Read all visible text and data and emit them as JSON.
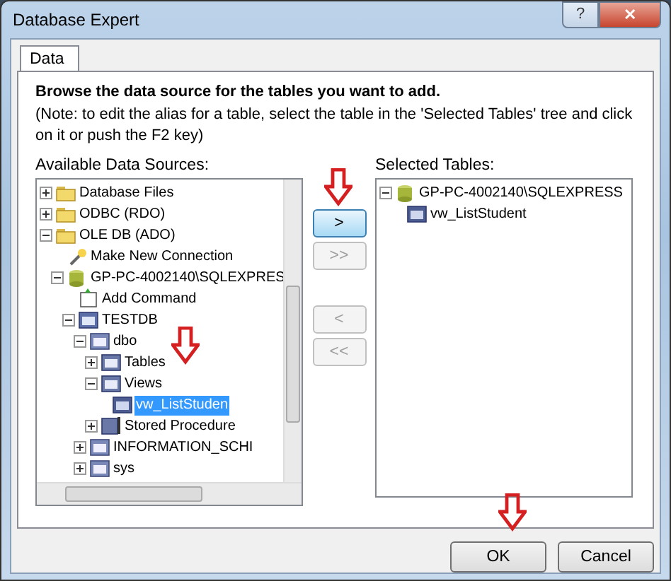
{
  "window": {
    "title": "Database Expert",
    "title_buttons": [
      {
        "kind": "help",
        "symbol": "?"
      },
      {
        "kind": "close",
        "symbol": "✕"
      }
    ]
  },
  "tabs": [
    {
      "label": "Data",
      "selected": true
    }
  ],
  "heading": "Browse the data source for the tables you want to add.",
  "note": "(Note: to edit the alias for a table, select the table in the 'Selected Tables' tree and click on it or push the F2 key)",
  "available_label": "Available Data Sources:",
  "available_tree": [
    {
      "label": "Database Files",
      "kind": "folder",
      "expanded": false,
      "selected": false
    },
    {
      "label": "ODBC (RDO)",
      "kind": "folder",
      "expanded": false,
      "selected": false
    },
    {
      "label": "OLE DB (ADO)",
      "kind": "folder",
      "expanded": true,
      "selected": false,
      "children": [
        {
          "label": "Make New Connection",
          "kind": "connection",
          "selected": false
        },
        {
          "label": "GP-PC-4002140\\SQLEXPRES",
          "kind": "server",
          "expanded": true,
          "selected": false,
          "children": [
            {
              "label": "Add Command",
              "kind": "command",
              "selected": false
            },
            {
              "label": "TESTDB",
              "kind": "database",
              "expanded": true,
              "selected": false,
              "children": [
                {
                  "label": "dbo",
                  "kind": "schema",
                  "expanded": true,
                  "selected": false,
                  "children": [
                    {
                      "label": "Tables",
                      "kind": "group",
                      "expanded": false,
                      "selected": false
                    },
                    {
                      "label": "Views",
                      "kind": "group",
                      "expanded": true,
                      "selected": false,
                      "children": [
                        {
                          "label": "vw_ListStuden",
                          "kind": "view",
                          "selected": true
                        }
                      ]
                    },
                    {
                      "label": "Stored Procedure",
                      "kind": "procedure",
                      "expanded": false,
                      "selected": false
                    }
                  ]
                },
                {
                  "label": "INFORMATION_SCHI",
                  "kind": "schema",
                  "expanded": false,
                  "selected": false
                },
                {
                  "label": "sys",
                  "kind": "schema",
                  "expanded": false,
                  "selected": false
                }
              ]
            }
          ]
        }
      ]
    }
  ],
  "transfer_buttons": [
    {
      "label": ">",
      "disabled": false
    },
    {
      "label": ">>",
      "disabled": true
    },
    {
      "label": "<",
      "disabled": true
    },
    {
      "label": "<<",
      "disabled": true
    }
  ],
  "selected_label": "Selected Tables:",
  "selected_tree": [
    {
      "label": "GP-PC-4002140\\SQLEXPRESS",
      "kind": "server",
      "expanded": true,
      "selected": false,
      "children": [
        {
          "label": "vw_ListStudent",
          "kind": "view",
          "selected": false
        }
      ]
    }
  ],
  "footer_buttons": [
    {
      "label": "OK"
    },
    {
      "label": "Cancel"
    }
  ]
}
